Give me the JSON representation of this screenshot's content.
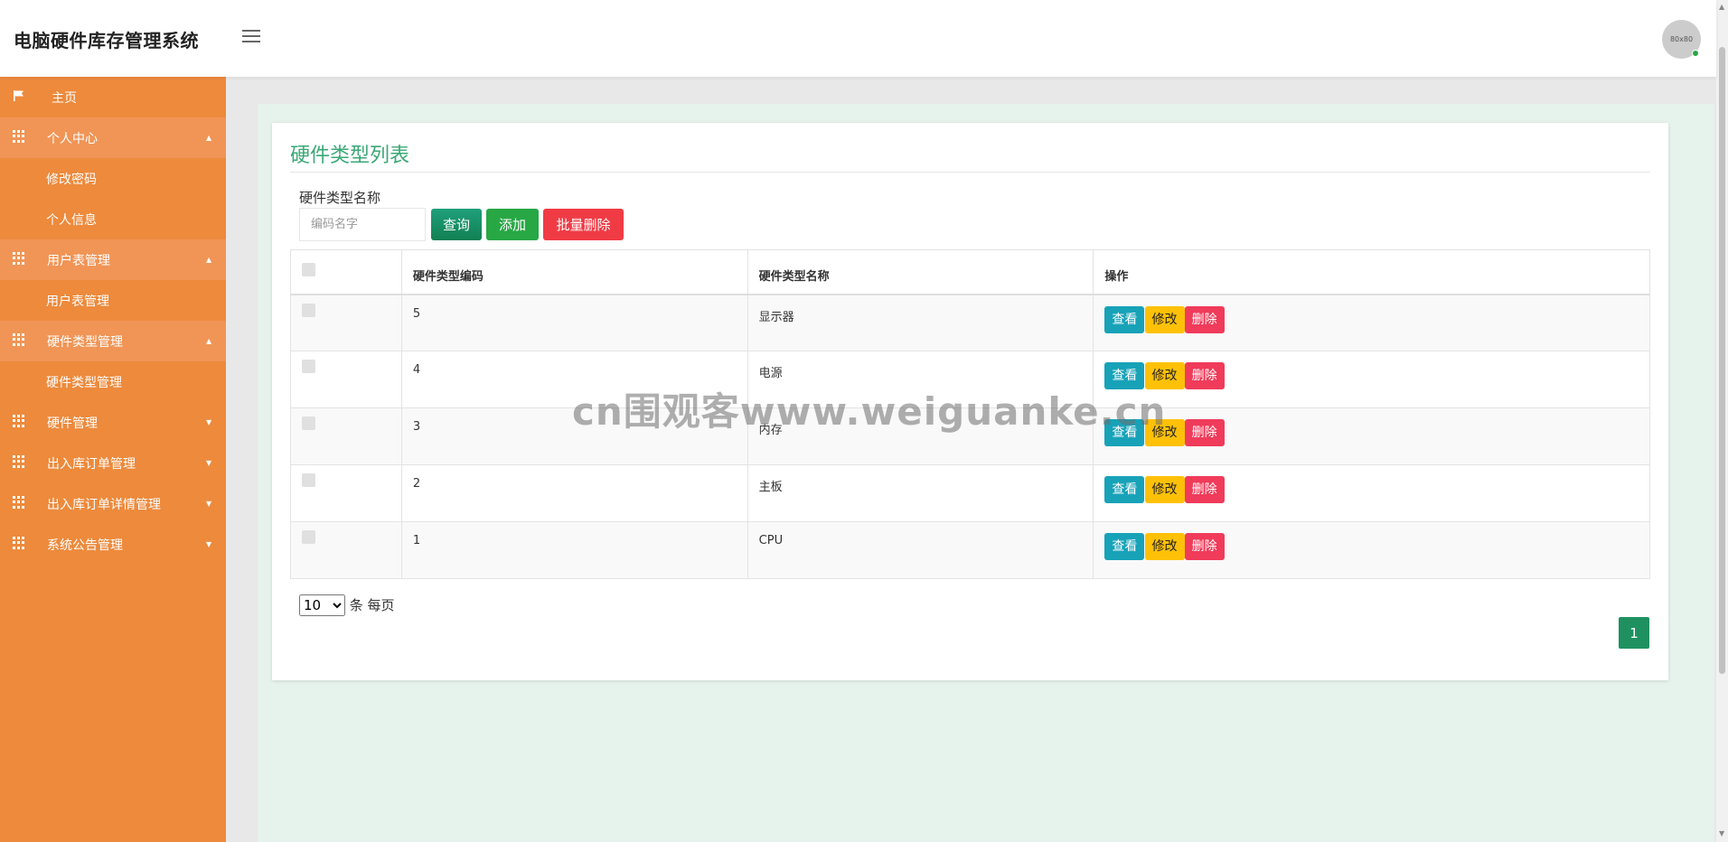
{
  "header": {
    "brand": "电脑硬件库存管理系统",
    "avatar_text": "80x80"
  },
  "sidebar": {
    "home": "主页",
    "groups": [
      {
        "label": "个人中心",
        "open": true,
        "children": [
          "修改密码",
          "个人信息"
        ]
      },
      {
        "label": "用户表管理",
        "open": true,
        "children": [
          "用户表管理"
        ]
      },
      {
        "label": "硬件类型管理",
        "open": true,
        "children": [
          "硬件类型管理"
        ]
      },
      {
        "label": "硬件管理",
        "open": false
      },
      {
        "label": "出入库订单管理",
        "open": false
      },
      {
        "label": "出入库订单详情管理",
        "open": false
      },
      {
        "label": "系统公告管理",
        "open": false
      }
    ]
  },
  "main": {
    "title": "硬件类型列表",
    "search": {
      "label": "硬件类型名称",
      "placeholder": "编码名字"
    },
    "buttons": {
      "query": "查询",
      "add": "添加",
      "bulk_delete": "批量删除"
    },
    "table": {
      "headers": [
        "硬件类型编码",
        "硬件类型名称",
        "操作"
      ],
      "rows": [
        {
          "code": "5",
          "name": "显示器"
        },
        {
          "code": "4",
          "name": "电源"
        },
        {
          "code": "3",
          "name": "内存"
        },
        {
          "code": "2",
          "name": "主板"
        },
        {
          "code": "1",
          "name": "CPU"
        }
      ],
      "actions": {
        "view": "查看",
        "edit": "修改",
        "delete": "删除"
      }
    },
    "page_size": {
      "value": "10",
      "suffix": "条 每页"
    },
    "pager": {
      "current": "1"
    }
  },
  "watermark": "cn围观客www.weiguanke.cn",
  "colors": {
    "sidebar": "#ed8a3c",
    "accent": "#3aa876",
    "query": "#118053",
    "add": "#28a745",
    "danger": "#f03b45",
    "view": "#17a2b8",
    "edit": "#ffc107"
  }
}
